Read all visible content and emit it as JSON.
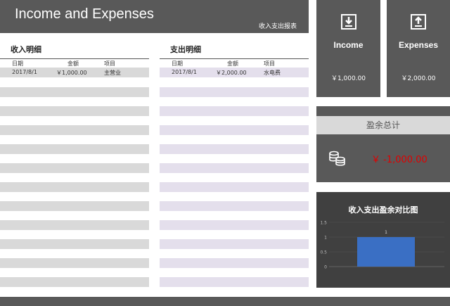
{
  "header": {
    "title": "Income and Expenses",
    "subtitle": "收入支出报表"
  },
  "income_table": {
    "title": "收入明细",
    "columns": [
      "日期",
      "金额",
      "项目"
    ],
    "rows": [
      [
        "2017/8/1",
        "￥1,000.00",
        "主营业"
      ]
    ]
  },
  "expense_table": {
    "title": "支出明细",
    "columns": [
      "日期",
      "金额",
      "项目"
    ],
    "rows": [
      [
        "2017/8/1",
        "￥2,000.00",
        "水电费"
      ]
    ]
  },
  "income_tile": {
    "label": "Income",
    "value": "￥1,000.00"
  },
  "expense_tile": {
    "label": "Expenses",
    "value": "￥2,000.00"
  },
  "surplus": {
    "label": "盈余总计",
    "value": "￥ -1,000.00"
  },
  "chart": {
    "title": "收入支出盈余对比图"
  },
  "chart_data": {
    "type": "bar",
    "title": "收入支出盈余对比图",
    "categories": [
      ""
    ],
    "values": [
      1
    ],
    "data_labels": [
      "1"
    ],
    "yticks": [
      "0",
      "0.5",
      "1",
      "1.5"
    ],
    "ylim": [
      0,
      1.5
    ],
    "grid": true,
    "bar_color": "#3a6fc4"
  },
  "colors": {
    "dark": "#595959",
    "gray_band": "#d9d9d9",
    "lavender_band": "#e4dfec",
    "negative": "#e00000"
  }
}
